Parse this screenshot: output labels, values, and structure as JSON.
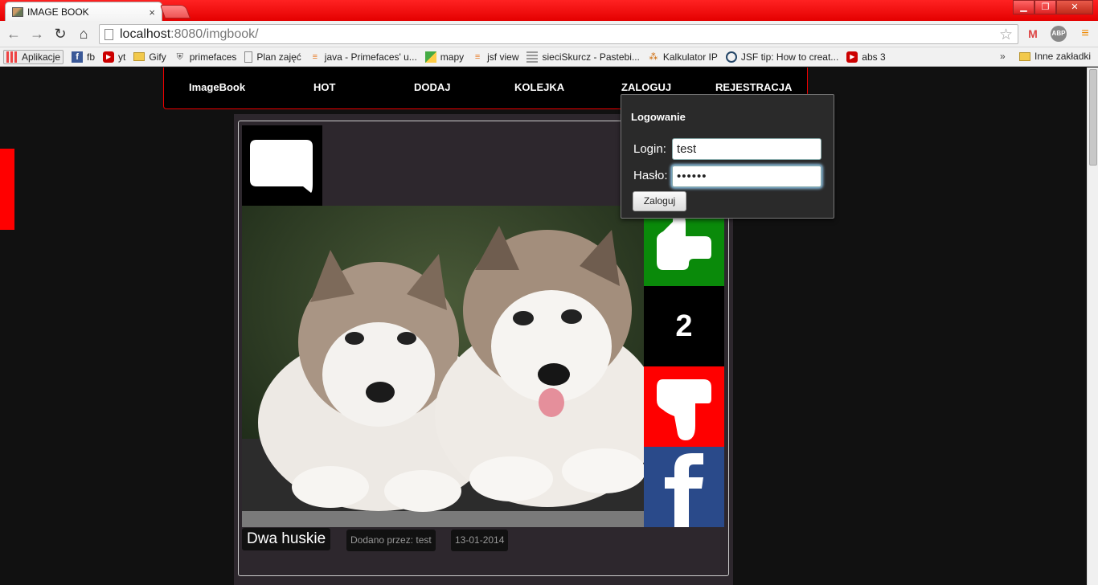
{
  "browser": {
    "tab_title": "IMAGE BOOK",
    "tab_close": "×",
    "url_host": "localhost",
    "url_rest": ":8080/imgbook/",
    "window_buttons": [
      "▁",
      "❐",
      "✕"
    ],
    "bookmarks": [
      {
        "label": "Aplikacje",
        "icon": "apps-grid-icon"
      },
      {
        "label": "fb",
        "icon": "facebook-icon"
      },
      {
        "label": "yt",
        "icon": "youtube-icon"
      },
      {
        "label": "Gify",
        "icon": "folder-icon"
      },
      {
        "label": "primefaces",
        "icon": "shield-icon"
      },
      {
        "label": "Plan zajęć",
        "icon": "page-icon"
      },
      {
        "label": "java - Primefaces' u...",
        "icon": "stackoverflow-icon"
      },
      {
        "label": "mapy",
        "icon": "maps-icon"
      },
      {
        "label": "jsf view",
        "icon": "stackoverflow-icon"
      },
      {
        "label": "sieciSkurcz - Pastebi...",
        "icon": "pastebin-icon"
      },
      {
        "label": "Kalkulator IP",
        "icon": "network-icon"
      },
      {
        "label": "JSF tip: How to creat...",
        "icon": "globe-icon"
      },
      {
        "label": "abs 3",
        "icon": "youtube-icon"
      }
    ],
    "bookmarks_more": "»",
    "other_bookmarks": "Inne zakładki"
  },
  "nav": {
    "items": [
      "ImageBook",
      "HOT",
      "DODAJ",
      "KOLEJKA",
      "ZALOGUJ",
      "REJESTRACJA"
    ]
  },
  "post": {
    "title": "Dwa huskie",
    "added_by": "Dodano przez: test",
    "date": "13-01-2014",
    "votes": "2"
  },
  "login": {
    "title": "Logowanie",
    "login_label": "Login:",
    "login_value": "test",
    "password_label": "Hasło:",
    "password_value": "••••••",
    "button": "Zaloguj"
  },
  "colors": {
    "accent": "#ff0000",
    "vote_up": "#0a8a0a",
    "vote_down": "#ff0000",
    "facebook": "#2a4a8a"
  }
}
